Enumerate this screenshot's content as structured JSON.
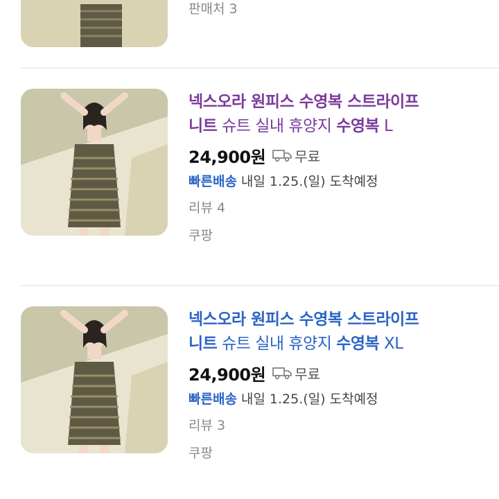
{
  "top_partial": {
    "seller": "판매처 3"
  },
  "products": [
    {
      "title_bold_1": "넥스오라 원피스 수영복 스트라이프",
      "title_bold_2": "니트",
      "title_plain_2": " 슈트 실내 휴양지 ",
      "title_bold_3": "수영복",
      "title_size": " L",
      "price": "24,900원",
      "shipping": "무료",
      "delivery_tag": "빠른배송",
      "delivery_text": "내일 1.25.(일) 도착예정",
      "reviews": "리뷰 4",
      "seller": "쿠팡"
    },
    {
      "title_bold_1": "넥스오라 원피스 수영복 스트라이프",
      "title_bold_2": "니트",
      "title_plain_2": " 슈트 실내 휴양지 ",
      "title_bold_3": "수영복",
      "title_size": " XL",
      "price": "24,900원",
      "shipping": "무료",
      "delivery_tag": "빠른배송",
      "delivery_text": "내일 1.25.(일) 도착예정",
      "reviews": "리뷰 3",
      "seller": "쿠팡"
    }
  ],
  "colors": {
    "visited_title": "#7a3b9c",
    "unvisited_title": "#2a64c6",
    "delivery_tag": "#2a64c6"
  },
  "icons": {
    "shipping": "truck-icon"
  }
}
